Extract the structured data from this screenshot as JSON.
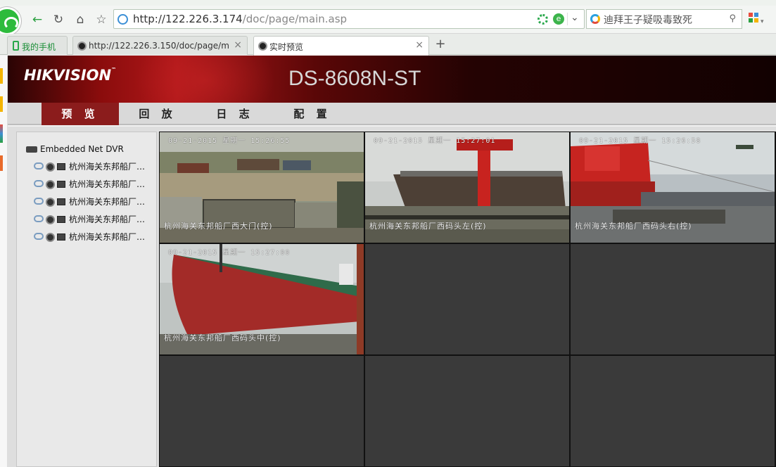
{
  "browser": {
    "url_main": "http://122.226.3.174",
    "url_path": "/doc/page/main.asp",
    "search_text": "迪拜王子疑吸毒致死",
    "tabs": [
      {
        "label": "我的手机"
      },
      {
        "label": "http://122.226.3.150/doc/page/ma"
      },
      {
        "label": "实时预览"
      }
    ]
  },
  "app": {
    "brand": "HIKVISION",
    "model": "DS-8608N-ST",
    "menu": [
      "预 览",
      "回 放",
      "日 志",
      "配 置"
    ]
  },
  "tree": {
    "root": "Embedded Net DVR",
    "channels": [
      "杭州海关东邦船厂…",
      "杭州海关东邦船厂…",
      "杭州海关东邦船厂…",
      "杭州海关东邦船厂…",
      "杭州海关东邦船厂…"
    ]
  },
  "views": [
    {
      "time": "09-21-2015 星期一 15:26:55",
      "name": "杭州海关东邦船厂西大门(控)"
    },
    {
      "time": "09-21-2015 星期一 15:27:01",
      "name": "杭州海关东邦船厂西码头左(控)"
    },
    {
      "time": "09-21-2015 星期一 15:26:58",
      "name": "杭州海关东邦船厂西码头右(控)"
    },
    {
      "time": "09-21-2015 星期一 15:27:00",
      "name": "杭州海关东邦船厂西码头中(控)"
    }
  ],
  "colors": {
    "accent": "#8b1c1c",
    "selected_border": "#d8b000"
  }
}
